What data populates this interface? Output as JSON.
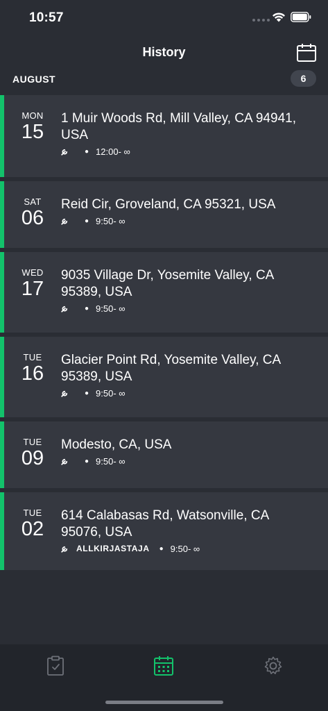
{
  "status_bar": {
    "time": "10:57"
  },
  "header": {
    "title": "History",
    "calendar_icon": "calendar-icon"
  },
  "section": {
    "title": "AUGUST",
    "count": "6"
  },
  "colors": {
    "accent": "#13c26b",
    "background": "#2a2d34",
    "card": "#353840",
    "tab_bar": "#22252b"
  },
  "items": [
    {
      "day_name": "MON",
      "day_num": "15",
      "address": "1 Muir Woods Rd, Mill Valley, CA 94941, USA",
      "signer": "",
      "time": "12:00- ∞"
    },
    {
      "day_name": "SAT",
      "day_num": "06",
      "address": "Reid Cir, Groveland, CA 95321, USA",
      "signer": "",
      "time": "9:50- ∞"
    },
    {
      "day_name": "WED",
      "day_num": "17",
      "address": "9035 Village Dr, Yosemite Valley, CA 95389, USA",
      "signer": "",
      "time": "9:50- ∞"
    },
    {
      "day_name": "TUE",
      "day_num": "16",
      "address": "Glacier Point Rd, Yosemite Valley, CA 95389, USA",
      "signer": "",
      "time": "9:50- ∞"
    },
    {
      "day_name": "TUE",
      "day_num": "09",
      "address": "Modesto, CA, USA",
      "signer": "",
      "time": "9:50- ∞"
    },
    {
      "day_name": "TUE",
      "day_num": "02",
      "address": "614 Calabasas Rd, Watsonville, CA 95076, USA",
      "signer": "ALLKIRJASTAJA",
      "time": "9:50- ∞"
    }
  ],
  "tabs": [
    {
      "icon": "clipboard-check-icon"
    },
    {
      "icon": "calendar-icon",
      "active": true
    },
    {
      "icon": "gear-icon"
    }
  ]
}
